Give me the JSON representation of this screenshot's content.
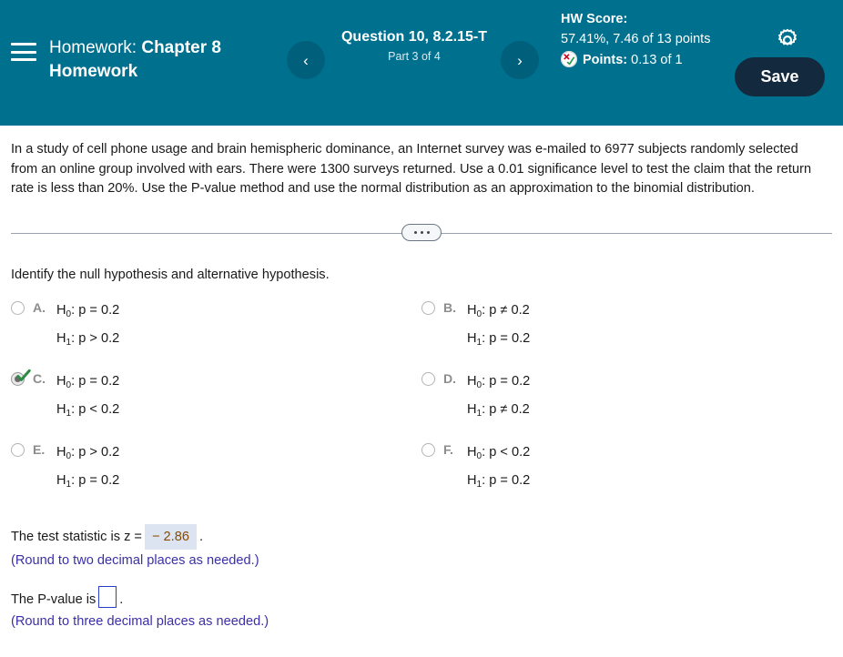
{
  "header": {
    "menu_icon": "hamburger-icon",
    "homework_label": "Homework:",
    "homework_name": "Chapter 8 Homework",
    "prev_icon": "‹",
    "next_icon": "›",
    "question_title": "Question 10, 8.2.15-T",
    "question_part": "Part 3 of 4",
    "hw_score_label": "HW Score:",
    "hw_score_value": "57.41%, 7.46 of 13 points",
    "points_label": "Points:",
    "points_value": "0.13 of 1",
    "gear_icon": "gear-icon",
    "save_label": "Save",
    "bg_color": "#00708f",
    "save_color": "#13293d"
  },
  "problem": {
    "text": "In a study of cell phone usage and brain hemispheric dominance, an Internet survey was e-mailed to 6977 subjects randomly selected from an online group involved with ears. There were 1300 surveys returned. Use a 0.01 significance level to test the claim that the return rate is less than 20%. Use the P-value method and use the normal distribution as an approximation to the binomial distribution."
  },
  "divider": {
    "dots_label": "more-options"
  },
  "question": {
    "prompt": "Identify the null hypothesis and alternative hypothesis."
  },
  "choices": [
    {
      "letter": "A.",
      "null_hyp": "H",
      "null_sub": "0",
      "null_rest": ": p = 0.2",
      "alt_hyp": "H",
      "alt_sub": "1",
      "alt_rest": ": p > 0.2",
      "selected": false,
      "correct": false
    },
    {
      "letter": "B.",
      "null_hyp": "H",
      "null_sub": "0",
      "null_rest": ": p ≠ 0.2",
      "alt_hyp": "H",
      "alt_sub": "1",
      "alt_rest": ": p = 0.2",
      "selected": false,
      "correct": false
    },
    {
      "letter": "C.",
      "null_hyp": "H",
      "null_sub": "0",
      "null_rest": ": p = 0.2",
      "alt_hyp": "H",
      "alt_sub": "1",
      "alt_rest": ": p < 0.2",
      "selected": true,
      "correct": true
    },
    {
      "letter": "D.",
      "null_hyp": "H",
      "null_sub": "0",
      "null_rest": ": p = 0.2",
      "alt_hyp": "H",
      "alt_sub": "1",
      "alt_rest": ": p ≠ 0.2",
      "selected": false,
      "correct": false
    },
    {
      "letter": "E.",
      "null_hyp": "H",
      "null_sub": "0",
      "null_rest": ": p > 0.2",
      "alt_hyp": "H",
      "alt_sub": "1",
      "alt_rest": ": p = 0.2",
      "selected": false,
      "correct": false
    },
    {
      "letter": "F.",
      "null_hyp": "H",
      "null_sub": "0",
      "null_rest": ": p < 0.2",
      "alt_hyp": "H",
      "alt_sub": "1",
      "alt_rest": ": p = 0.2",
      "selected": false,
      "correct": false
    }
  ],
  "answers": {
    "test_stat_prefix": "The test statistic is z =",
    "test_stat_value": "− 2.86",
    "test_stat_suffix": ".",
    "test_stat_hint": "(Round to two decimal places as needed.)",
    "pvalue_prefix": "The P-value is",
    "pvalue_value": "",
    "pvalue_suffix": ".",
    "pvalue_hint": "(Round to three decimal places as needed.)"
  }
}
